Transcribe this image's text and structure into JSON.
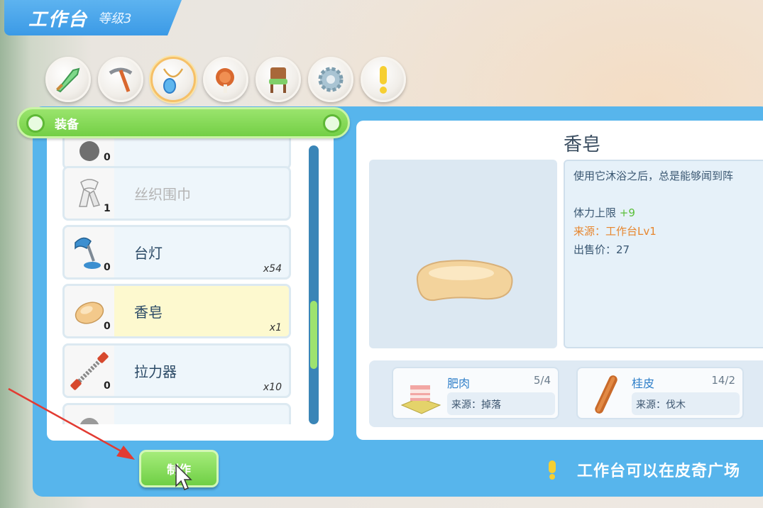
{
  "header": {
    "title": "工作台",
    "level": "等级3"
  },
  "categories": [
    {
      "icon": "sword-icon",
      "active": false
    },
    {
      "icon": "pickaxe-icon",
      "active": false
    },
    {
      "icon": "necklace-icon",
      "active": true
    },
    {
      "icon": "meat-icon",
      "active": false
    },
    {
      "icon": "chair-icon",
      "active": false
    },
    {
      "icon": "gear-icon",
      "active": false
    },
    {
      "icon": "exclamation-icon",
      "active": false
    }
  ],
  "tab": {
    "label": "装备"
  },
  "items": [
    {
      "name": "",
      "count": "0",
      "qty": "",
      "locked": true,
      "icon": "dark-item-icon"
    },
    {
      "name": "丝织围巾",
      "count": "1",
      "qty": "",
      "locked": true,
      "icon": "scarf-icon"
    },
    {
      "name": "台灯",
      "count": "0",
      "qty": "x54",
      "locked": false,
      "icon": "desk-lamp-icon"
    },
    {
      "name": "香皂",
      "count": "0",
      "qty": "x1",
      "locked": false,
      "selected": true,
      "icon": "soap-icon"
    },
    {
      "name": "拉力器",
      "count": "0",
      "qty": "x10",
      "locked": false,
      "icon": "chest-expander-icon"
    },
    {
      "name": "",
      "count": "",
      "qty": "",
      "locked": true,
      "icon": "dark-item-icon"
    }
  ],
  "detail": {
    "title": "香皂",
    "description": "使用它沐浴之后，总是能够闻到阵",
    "stat_label": "体力上限",
    "stat_value": "+9",
    "source": "来源：工作台Lv1",
    "sell_price": "出售价：27"
  },
  "materials": [
    {
      "name": "肥肉",
      "count": "5/4",
      "source": "来源：掉落",
      "icon": "fat-meat-icon"
    },
    {
      "name": "桂皮",
      "count": "14/2",
      "source": "来源：伐木",
      "icon": "cinnamon-icon"
    }
  ],
  "actions": {
    "make_label": "制作"
  },
  "tip": {
    "text": "工作台可以在皮奇广场"
  },
  "colors": {
    "panel_blue": "#57b5ec",
    "accent_green": "#73cf45",
    "stat_green": "#5bbf3a",
    "source_orange": "#e7862e"
  }
}
